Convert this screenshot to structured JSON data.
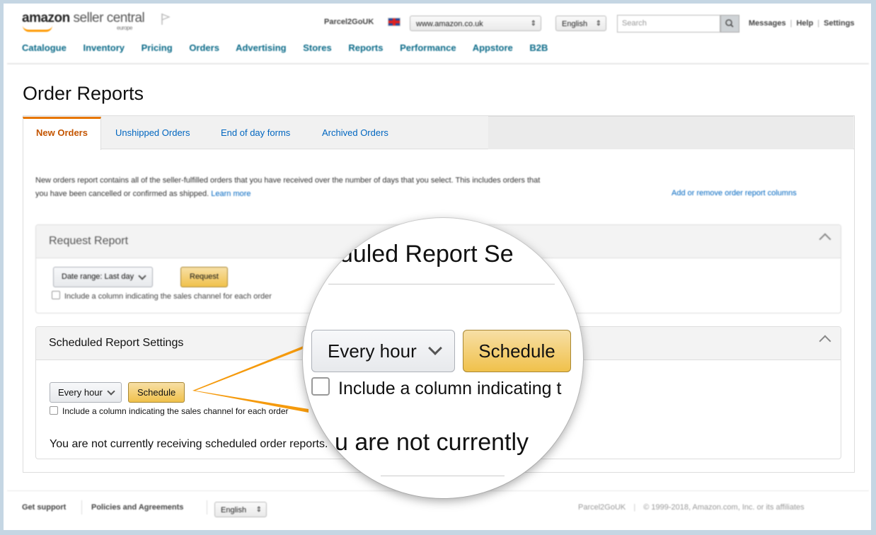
{
  "header": {
    "logo_main": "amazon",
    "logo_light": " seller central",
    "logo_sub": "europe",
    "store_name": "Parcel2GoUK",
    "marketplace": "www.amazon.co.uk",
    "language": "English",
    "search_placeholder": "Search",
    "links": [
      "Messages",
      "Help",
      "Settings"
    ]
  },
  "nav": [
    "Catalogue",
    "Inventory",
    "Pricing",
    "Orders",
    "Advertising",
    "Stores",
    "Reports",
    "Performance",
    "Appstore",
    "B2B"
  ],
  "page": {
    "title": "Order Reports",
    "tabs": [
      "New Orders",
      "Unshipped Orders",
      "End of day forms",
      "Archived Orders"
    ],
    "description": "New orders report contains all of the seller-fulfilled orders that you have received over the number of days that you select. This includes orders that you have been cancelled or confirmed as shipped.",
    "learn_more": "Learn more",
    "add_columns": "Add or remove order report columns"
  },
  "request_report": {
    "title": "Request Report",
    "date_range": "Date range: Last day",
    "request_label": "Request",
    "include_label": "Include a column indicating the sales channel for each order"
  },
  "scheduled": {
    "title": "Scheduled Report Settings",
    "frequency": "Every hour",
    "schedule_label": "Schedule",
    "include_label": "Include a column indicating the sales channel for each order",
    "status": "You are not currently receiving scheduled order reports."
  },
  "magnifier": {
    "title": "eduled Report Se",
    "frequency": "Every hour",
    "schedule_label": "Schedule",
    "include_label": "Include a column indicating t",
    "status": "u are not currently"
  },
  "footer": {
    "links": [
      "Get support",
      "Policies and Agreements"
    ],
    "language": "English",
    "store": "Parcel2GoUK",
    "copyright": "© 1999-2018, Amazon.com, Inc. or its affiliates"
  },
  "colors": {
    "accent_orange": "#f59a0c",
    "link_blue": "#0066c0",
    "active_tab": "#c45500",
    "button_yellow": "#f0c14b"
  }
}
